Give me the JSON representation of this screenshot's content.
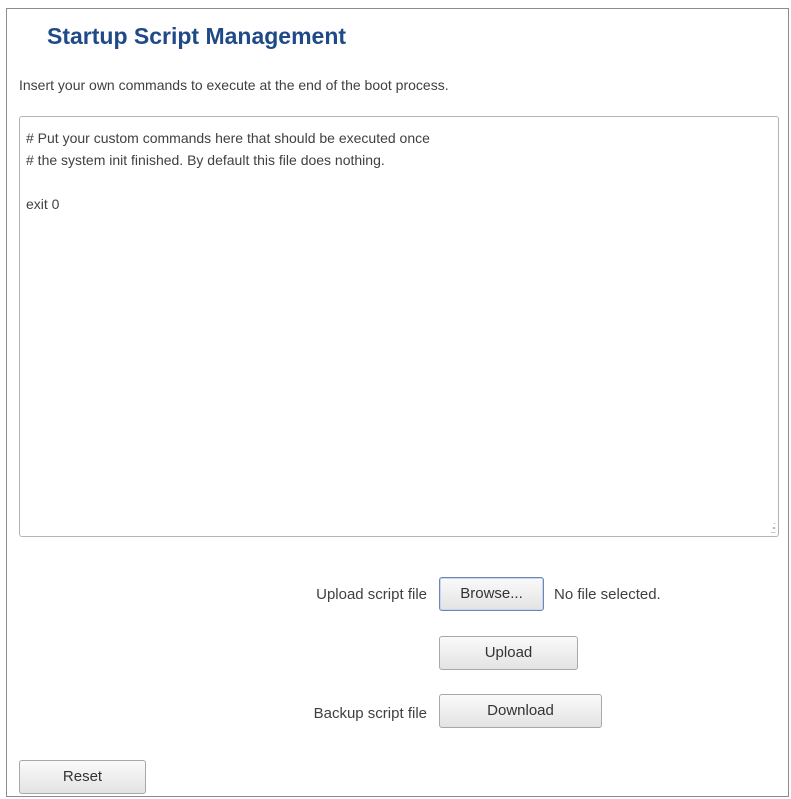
{
  "page": {
    "title": "Startup Script Management",
    "description": "Insert your own commands to execute at the end of the boot process."
  },
  "editor": {
    "content": "# Put your custom commands here that should be executed once\n# the system init finished. By default this file does nothing.\n\nexit 0"
  },
  "upload": {
    "label": "Upload script file",
    "browse_label": "Browse...",
    "file_status": "No file selected.",
    "upload_button": "Upload"
  },
  "backup": {
    "label": "Backup script file",
    "download_button": "Download"
  },
  "actions": {
    "reset_button": "Reset"
  },
  "colors": {
    "title": "#204a87",
    "text": "#404040",
    "border": "#8c8c8c"
  }
}
